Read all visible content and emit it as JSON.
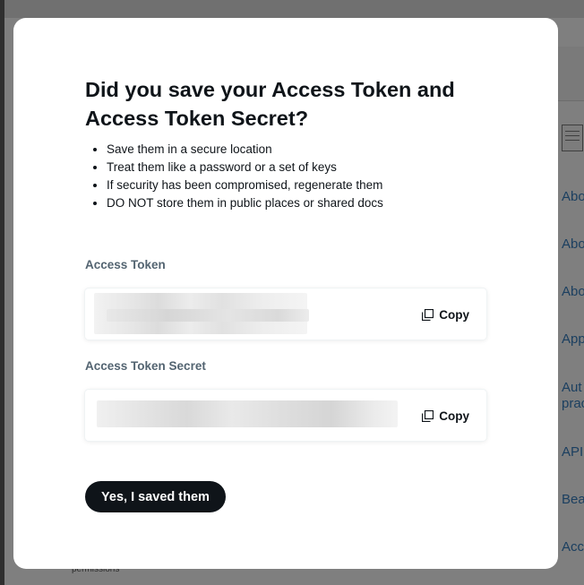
{
  "dialog": {
    "title": "Did you save your Access Token and Access Token Secret?",
    "tips": [
      "Save them in a secure location",
      "Treat them like a password or a set of keys",
      "If security has been compromised, regenerate them",
      "DO NOT store them in public places or shared docs"
    ],
    "access_token": {
      "label": "Access Token",
      "copy_label": "Copy"
    },
    "access_token_secret": {
      "label": "Access Token Secret",
      "copy_label": "Copy"
    },
    "confirm_label": "Yes, I saved them"
  },
  "background": {
    "links": [
      "Abo",
      "Abo",
      "Abo",
      "App",
      "Aut",
      "prac",
      "API",
      "Bea",
      "Acc"
    ],
    "footer_text": "permissions"
  },
  "colors": {
    "primary_text": "#0f1419",
    "secondary_text": "#536471",
    "button_bg": "#0f1419"
  }
}
